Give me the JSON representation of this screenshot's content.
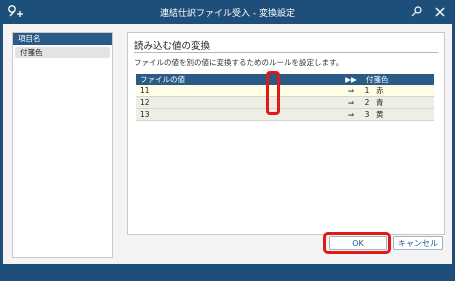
{
  "window": {
    "title": "連結仕訳ファイル受入 - 変換設定"
  },
  "left_panel": {
    "header": "項目名",
    "items": [
      {
        "label": "付箋色"
      }
    ]
  },
  "right_panel": {
    "title": "読み込む値の変換",
    "description": "ファイルの値を別の値に変換するためのルールを設定します。",
    "table": {
      "headers": {
        "file_value": "ファイルの値",
        "arrow": "▶▶",
        "target": "付箋色"
      },
      "rows": [
        {
          "file_value": "11",
          "arrow": "⇒",
          "num": "1",
          "name": "赤"
        },
        {
          "file_value": "12",
          "arrow": "⇒",
          "num": "2",
          "name": "青"
        },
        {
          "file_value": "13",
          "arrow": "⇒",
          "num": "3",
          "name": "黄"
        }
      ]
    }
  },
  "buttons": {
    "ok": "OK",
    "cancel": "キャンセル"
  },
  "colors": {
    "frame": "#1e4f7a",
    "header": "#2a5b86",
    "highlight": "#e01919"
  },
  "icons": {
    "app": "key-plus-icon",
    "pin": "pin-icon",
    "close": "close-icon"
  }
}
